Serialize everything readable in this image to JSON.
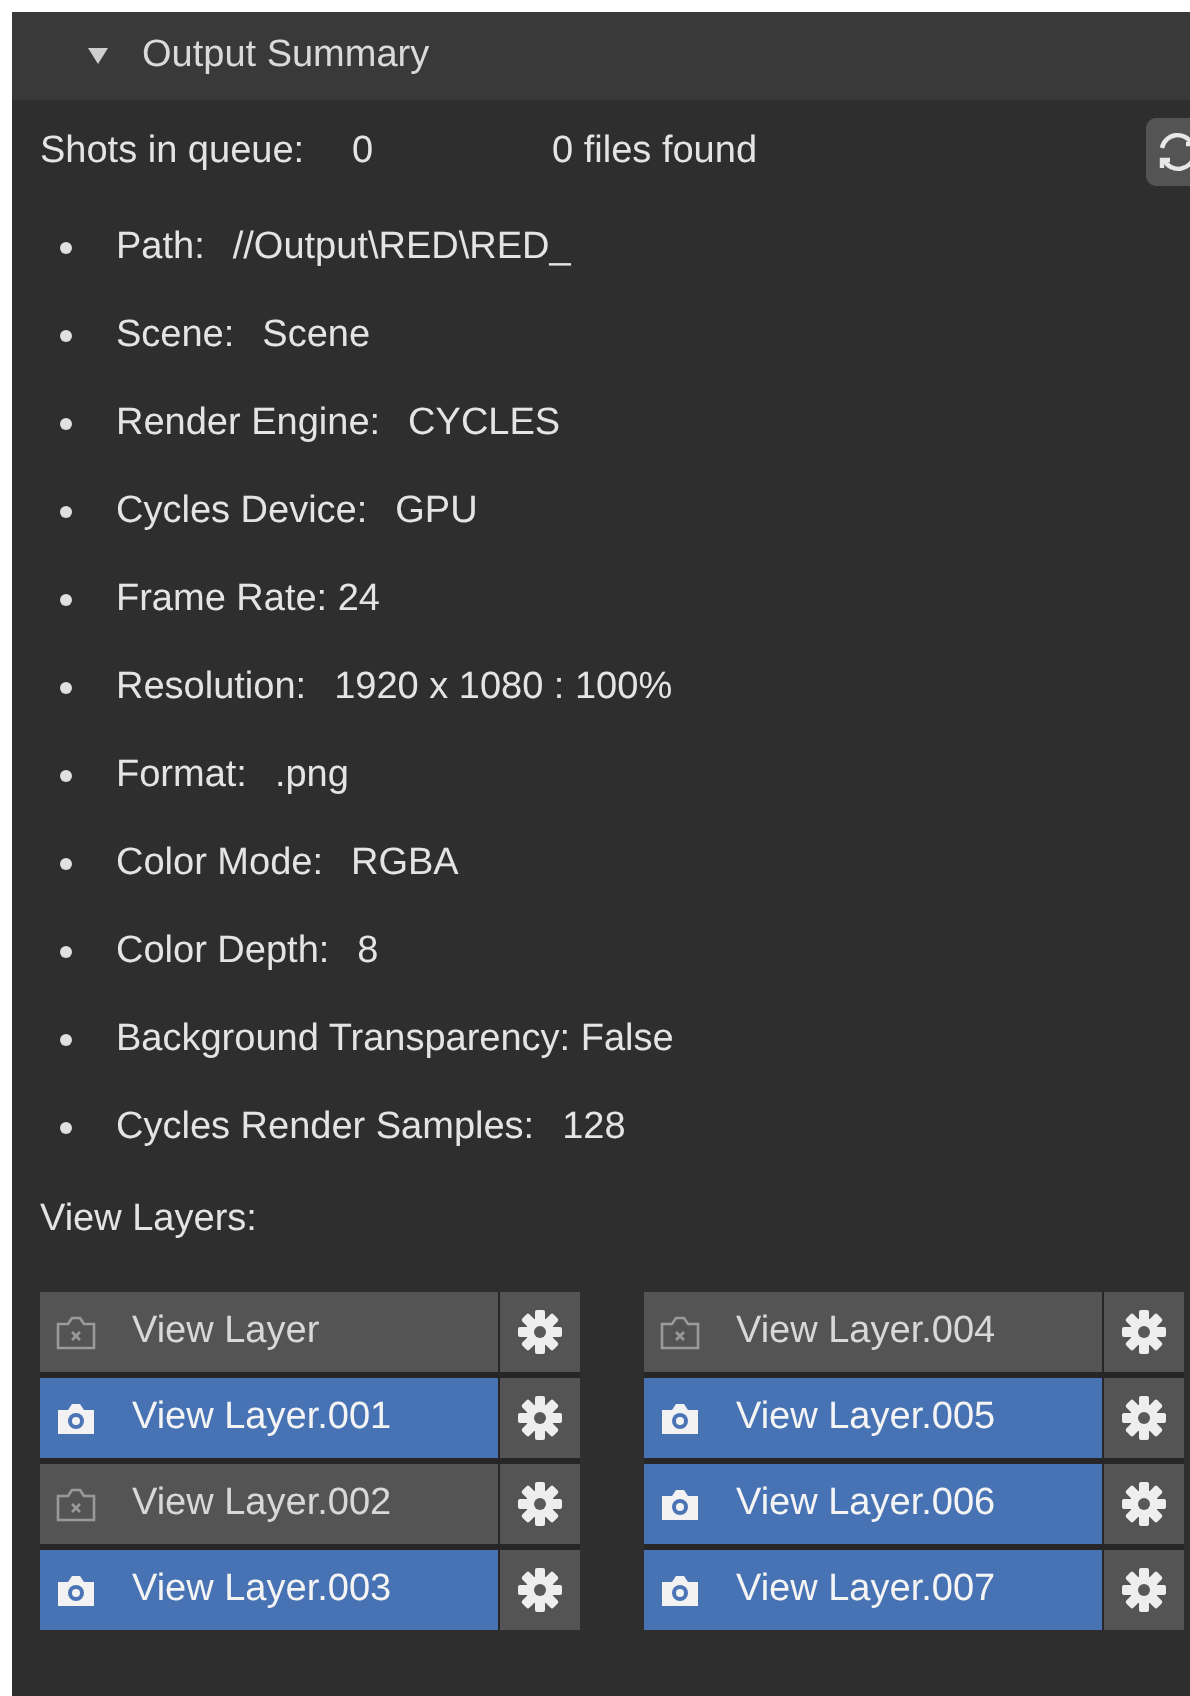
{
  "panel": {
    "title": "Output Summary",
    "expanded": true
  },
  "queue": {
    "label": "Shots in queue:",
    "count": "0",
    "files": "0 files found"
  },
  "details": [
    {
      "label": "Path:",
      "value": "//Output\\RED\\RED_"
    },
    {
      "label": "Scene:",
      "value": "Scene"
    },
    {
      "label": "Render Engine:",
      "value": "CYCLES"
    },
    {
      "label": "Cycles Device:",
      "value": "GPU"
    },
    {
      "label": "Frame Rate: 24"
    },
    {
      "label": "Resolution:",
      "value": "1920 x 1080 : 100%"
    },
    {
      "label": "Format:",
      "value": ".png"
    },
    {
      "label": "Color Mode:",
      "value": "RGBA"
    },
    {
      "label": "Color Depth:",
      "value": "8"
    },
    {
      "label": "Background Transparency: False"
    },
    {
      "label": "Cycles Render Samples:",
      "value": "128"
    }
  ],
  "view_layers_label": "View Layers:",
  "view_layers": [
    [
      {
        "name": "View Layer",
        "enabled": false
      },
      {
        "name": "View Layer.001",
        "enabled": true
      },
      {
        "name": "View Layer.002",
        "enabled": false
      },
      {
        "name": "View Layer.003",
        "enabled": true
      }
    ],
    [
      {
        "name": "View Layer.004",
        "enabled": false
      },
      {
        "name": "View Layer.005",
        "enabled": true
      },
      {
        "name": "View Layer.006",
        "enabled": true
      },
      {
        "name": "View Layer.007",
        "enabled": true
      }
    ]
  ]
}
